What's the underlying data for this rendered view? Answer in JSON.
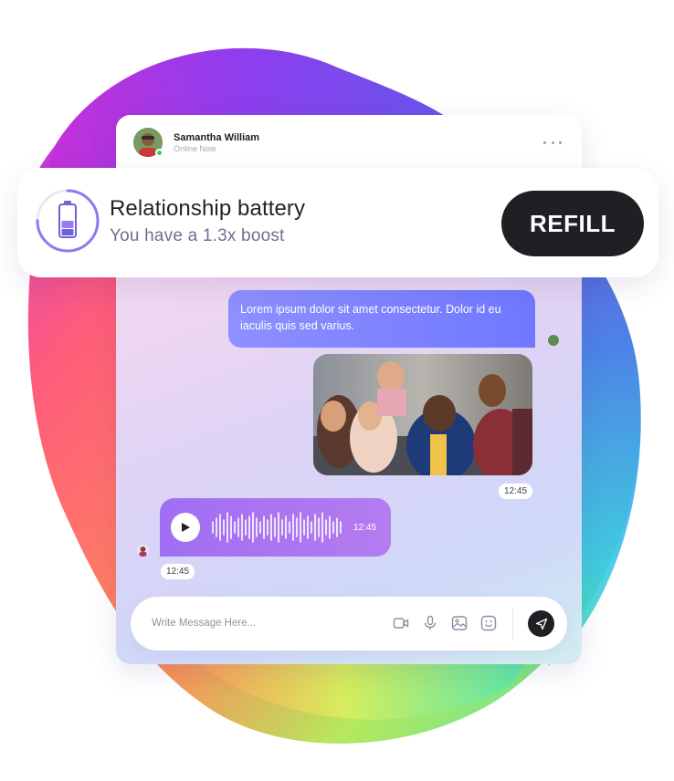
{
  "colors": {
    "dark_button": "#1f2024",
    "bubble_blue": "#7a80ff",
    "bubble_purple": "#a975f1",
    "online_green": "#2fd36b"
  },
  "chat": {
    "contact_name": "Samantha William",
    "contact_status": "Online Now",
    "more_icon": "more-horizontal-icon"
  },
  "battery_card": {
    "title": "Relationship battery",
    "subtitle": "You have a 1.3x boost",
    "refill_label": "REFILL",
    "battery_level": 0.5,
    "icon": "battery-icon"
  },
  "messages": {
    "text_message": "Lorem ipsum dolor sit amet consectetur. Dolor id eu iaculis quis sed varius.",
    "photo_time": "12:45",
    "voice_duration": "12:45",
    "voice_time": "12:45"
  },
  "composer": {
    "placeholder": "Write Message Here...",
    "icons": [
      "video-icon",
      "microphone-icon",
      "image-icon",
      "emoji-icon",
      "send-icon"
    ]
  }
}
